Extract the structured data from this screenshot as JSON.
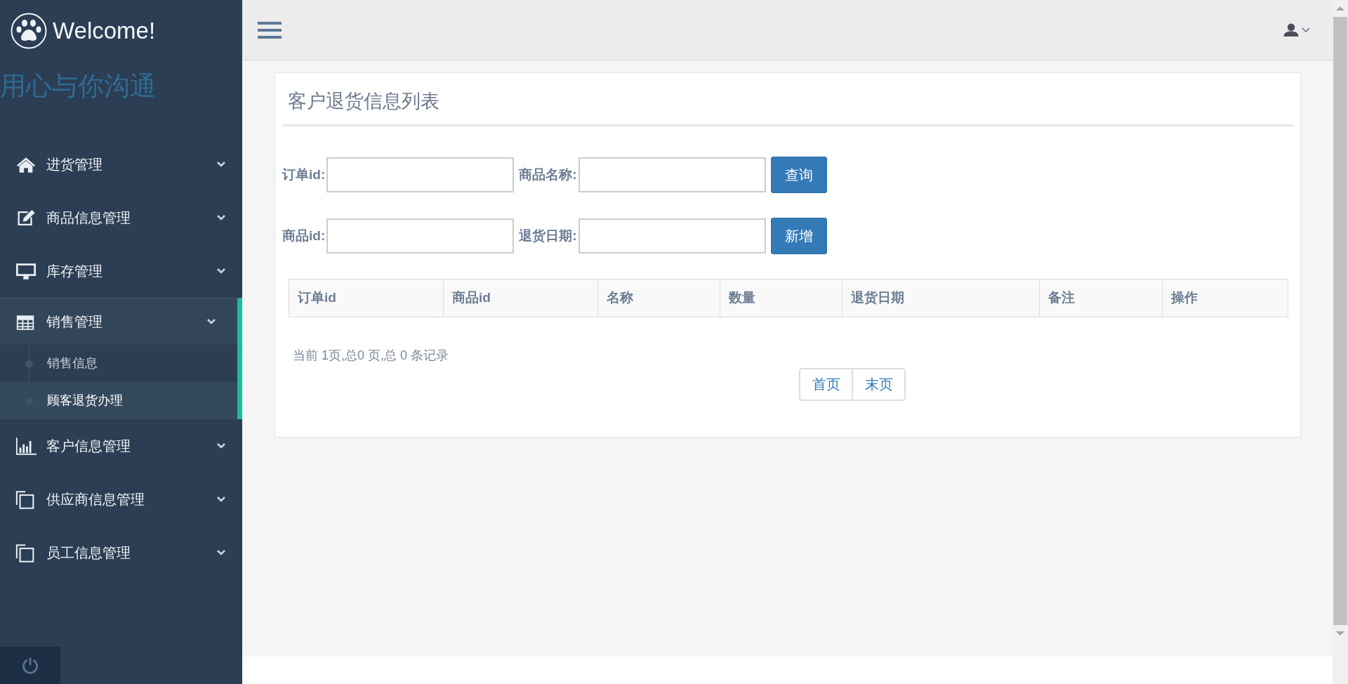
{
  "sidebar": {
    "brand": "Welcome!",
    "slogan": "用心与你沟通",
    "menu": [
      {
        "label": "进货管理",
        "kind": "home",
        "expanded": false
      },
      {
        "label": "商品信息管理",
        "kind": "edit",
        "expanded": false
      },
      {
        "label": "库存管理",
        "kind": "monitor",
        "expanded": false
      },
      {
        "label": "销售管理",
        "kind": "table",
        "expanded": true,
        "children": [
          {
            "label": "销售信息",
            "selected": false
          },
          {
            "label": "顾客退货办理",
            "selected": true
          }
        ]
      },
      {
        "label": "客户信息管理",
        "kind": "chart",
        "expanded": false
      },
      {
        "label": "供应商信息管理",
        "kind": "copy",
        "expanded": false
      },
      {
        "label": "员工信息管理",
        "kind": "copy",
        "expanded": false
      }
    ]
  },
  "panel": {
    "title": "客户退货信息列表",
    "filter_rows": [
      {
        "fields": [
          {
            "label": "订单id:"
          },
          {
            "label": "商品名称:"
          }
        ],
        "button": "查询"
      },
      {
        "fields": [
          {
            "label": "商品id:"
          },
          {
            "label": "退货日期:"
          }
        ],
        "button": "新增"
      }
    ],
    "table": {
      "columns": [
        "订单id",
        "商品id",
        "名称",
        "数量",
        "退货日期",
        "备注",
        "操作"
      ]
    },
    "summary": "当前 1页,总0 页,总 0 条记录",
    "pagination": [
      "首页",
      "末页"
    ]
  }
}
